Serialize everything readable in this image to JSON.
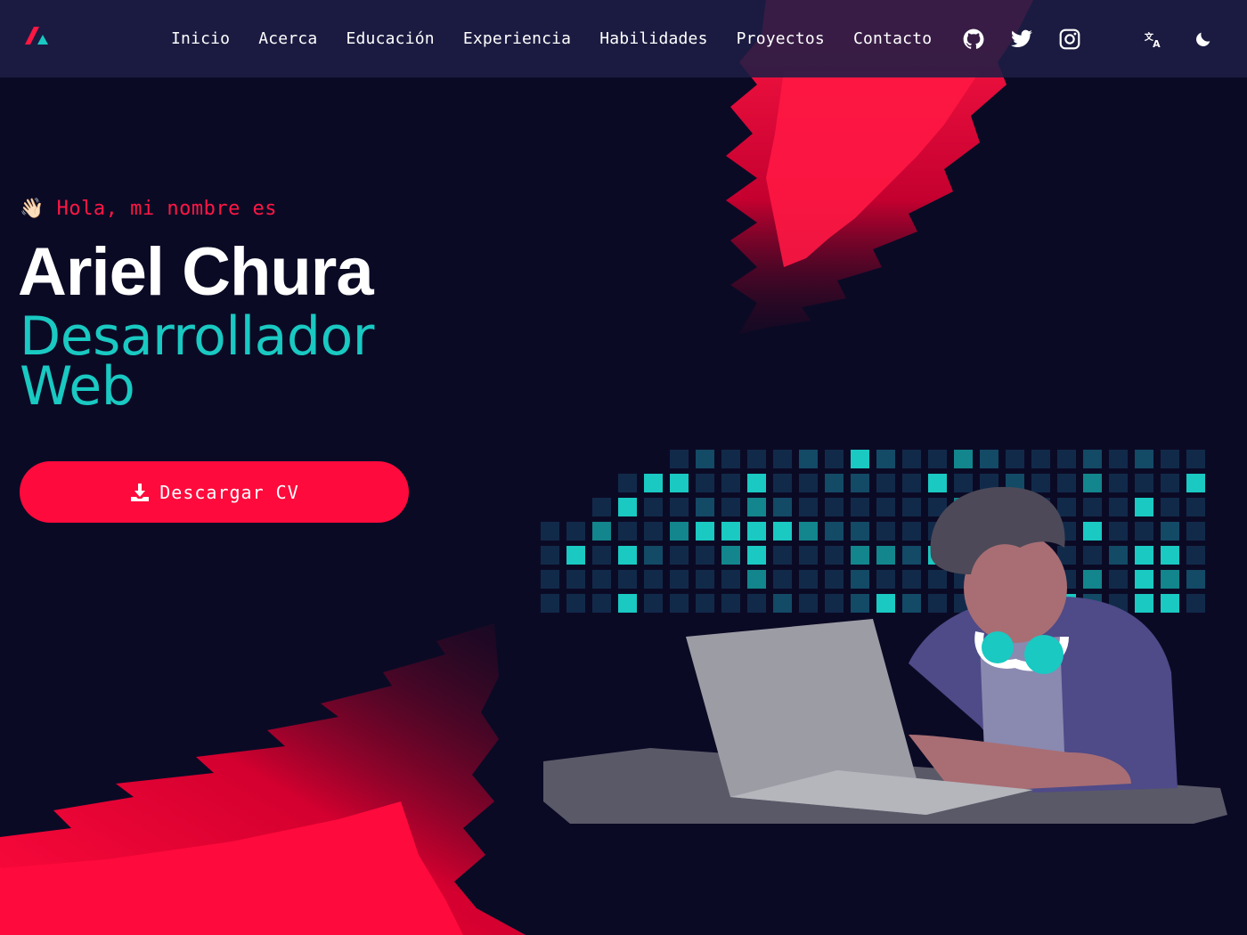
{
  "header": {
    "nav": [
      {
        "label": "Inicio"
      },
      {
        "label": "Acerca"
      },
      {
        "label": "Educación"
      },
      {
        "label": "Experiencia"
      },
      {
        "label": "Habilidades"
      },
      {
        "label": "Proyectos"
      },
      {
        "label": "Contacto"
      }
    ],
    "social_icons": [
      "github-icon",
      "twitter-icon",
      "instagram-icon"
    ],
    "tools": [
      "translate-icon",
      "moon-icon"
    ]
  },
  "hero": {
    "greeting": "👋🏻 Hola, mi nombre es",
    "name": "Ariel Chura",
    "role_line1": "Desarrollador",
    "role_line2": "Web",
    "cv_button": "Descargar CV"
  },
  "colors": {
    "background": "#0b0a25",
    "navbar": "#1e1e46",
    "accent_red": "#ff0a3c",
    "accent_teal": "#19c9c2",
    "text": "#ffffff"
  }
}
